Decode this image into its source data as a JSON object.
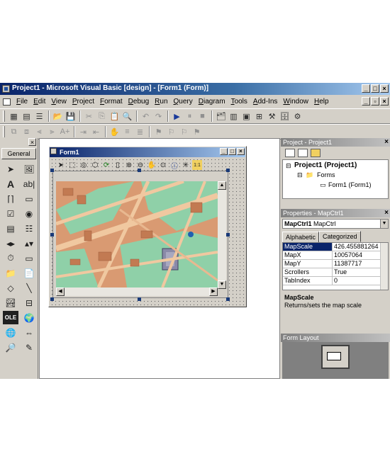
{
  "window": {
    "title": "Project1 - Microsoft Visual Basic [design] - [Form1 (Form)]"
  },
  "menu": [
    "File",
    "Edit",
    "View",
    "Project",
    "Format",
    "Debug",
    "Run",
    "Query",
    "Diagram",
    "Tools",
    "Add-Ins",
    "Window",
    "Help"
  ],
  "toolbox": {
    "tab_label": "General"
  },
  "form": {
    "title": "Form1"
  },
  "project_explorer": {
    "title": "Project - Project1",
    "root": "Project1 (Project1)",
    "folder": "Forms",
    "item": "Form1 (Form1)"
  },
  "properties": {
    "title": "Properties - MapCtrl1",
    "object_name": "MapCtrl1",
    "object_type": "MapCtrl",
    "tabs": [
      "Alphabetic",
      "Categorized"
    ],
    "rows": [
      {
        "key": "MapScale",
        "value": "426.455881264"
      },
      {
        "key": "MapX",
        "value": "10057064"
      },
      {
        "key": "MapY",
        "value": "11387717"
      },
      {
        "key": "Scrollers",
        "value": "True"
      },
      {
        "key": "TabIndex",
        "value": "0"
      }
    ],
    "description_title": "MapScale",
    "description_text": "Returns/sets the map scale"
  },
  "form_layout": {
    "title": "Form Layout"
  },
  "colors": {
    "titlebar": "#0a246a",
    "map_buildings": "#d99a72",
    "map_green": "#8fd0a8",
    "map_road": "#f0c8a0",
    "selection": "#0a246a"
  }
}
